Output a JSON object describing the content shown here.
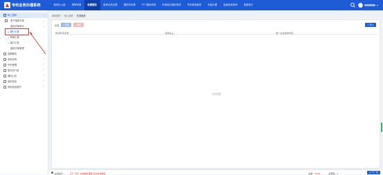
{
  "app": {
    "brand": "专利业务办理系统"
  },
  "topnav": {
    "items": [
      {
        "label": "我的办公桌"
      },
      {
        "label": "预审申请"
      },
      {
        "label": "收费服务"
      },
      {
        "label": "复审无效办理"
      },
      {
        "label": "通知书办理"
      },
      {
        "label": "PCT国际申请"
      },
      {
        "label": "外观设计国际申请"
      },
      {
        "label": "专利事务服务"
      },
      {
        "label": "手续办理"
      },
      {
        "label": "高级检索查询"
      },
      {
        "label": "费用统计"
      }
    ],
    "active_index": 2
  },
  "sidebar": {
    "items": [
      {
        "label": "网上缴费",
        "level": "top"
      },
      {
        "label": "电子缴费清单",
        "level": "sub"
      },
      {
        "label": "缴费清单填写",
        "level": "sub"
      },
      {
        "label": "银行汇款",
        "level": "sub2"
      },
      {
        "label": "邮局汇款",
        "level": "sub2"
      },
      {
        "label": "窗口汇款",
        "level": "sub2"
      },
      {
        "label": "缴费清单管理",
        "level": "sub2b"
      },
      {
        "label": "费额服务",
        "level": "top2"
      },
      {
        "label": "费用查询",
        "level": "top2"
      },
      {
        "label": "专利管理",
        "level": "top2"
      },
      {
        "label": "暂存的介绍",
        "level": "top2"
      },
      {
        "label": "通知公告",
        "level": "top2"
      },
      {
        "label": "我的信息",
        "level": "top2"
      },
      {
        "label": "常用信息维护",
        "level": "top2"
      }
    ]
  },
  "breadcrumb": [
    "缴费服务",
    "网上缴费",
    "在线缴费"
  ],
  "toolbar": {
    "filter_label": "全选",
    "add_label": "添加",
    "delete_label": "删除",
    "import_label": "导入"
  },
  "table": {
    "columns": [
      "申请号/专利号：",
      "费用名头：",
      "统一社会信用代码："
    ],
    "empty_text": "暂无数据"
  },
  "footer": {
    "tip_label": "友情提示：",
    "tip_text": "【下一步】生成缴费通知书请在线缴费",
    "total_label": "总额：",
    "total_value": "¥0.00",
    "count_label": "总笔数：",
    "count_value": "0",
    "next_label": "下一步"
  },
  "colors": {
    "primary": "#1e5bd6",
    "nav_active": "#0f3fa9",
    "annotation": "#e23535"
  }
}
